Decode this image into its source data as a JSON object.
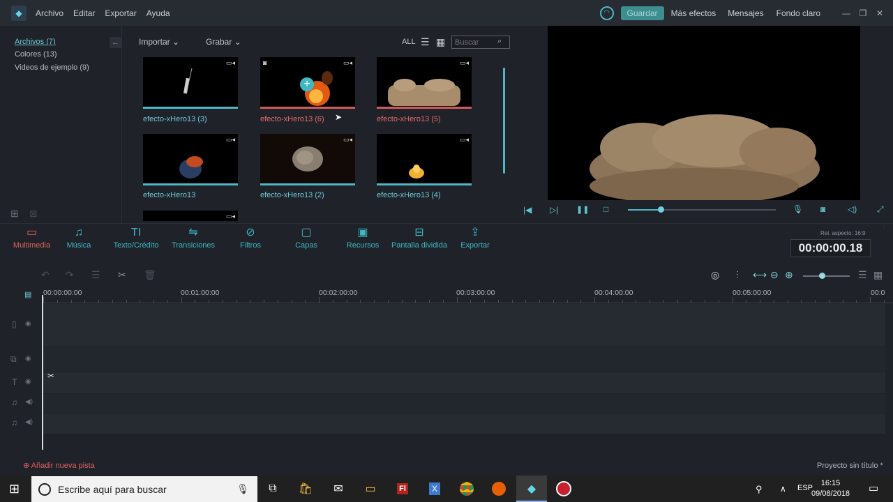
{
  "menu": [
    "Archivo",
    "Editar",
    "Exportar",
    "Ayuda"
  ],
  "top_right": {
    "save": "Guardar",
    "links": [
      "Más efectos",
      "Mensajes",
      "Fondo claro"
    ]
  },
  "sidebar": {
    "items": [
      {
        "label": "Archivos (7)"
      },
      {
        "label": "Colores (13)"
      },
      {
        "label": "Videos de ejemplo (9)"
      }
    ]
  },
  "media_toolbar": {
    "import": "Importar",
    "record": "Grabar",
    "all": "ALL",
    "search_placeholder": "Buscar"
  },
  "thumbnails": [
    {
      "label": "efecto-xHero13 (3)",
      "state": "normal"
    },
    {
      "label": "efecto-xHero13 (6)",
      "state": "selected"
    },
    {
      "label": "efecto-xHero13 (5)",
      "state": "selected"
    },
    {
      "label": "efecto-xHero13",
      "state": "normal"
    },
    {
      "label": "efecto-xHero13 (2)",
      "state": "normal"
    },
    {
      "label": "efecto-xHero13 (4)",
      "state": "normal"
    }
  ],
  "player": {
    "progress": 0.22
  },
  "tabs": [
    {
      "label": "Multimedia",
      "icon": "folder-icon",
      "active": true
    },
    {
      "label": "Música",
      "icon": "music-icon"
    },
    {
      "label": "Texto/Crédito",
      "icon": "text-icon"
    },
    {
      "label": "Transiciones",
      "icon": "transition-icon"
    },
    {
      "label": "Filtros",
      "icon": "filter-icon"
    },
    {
      "label": "Capas",
      "icon": "overlay-icon"
    },
    {
      "label": "Recursos",
      "icon": "image-icon"
    },
    {
      "label": "Pantalla dividida",
      "icon": "split-screen-icon"
    },
    {
      "label": "Exportar",
      "icon": "export-icon"
    }
  ],
  "aspect": "Rel. aspecto: 16:9",
  "timecode": "00:00:00.18",
  "ruler": [
    "00:00:00:00",
    "00:01:00:00",
    "00:02:00:00",
    "00:03:00:00",
    "00:04:00:00",
    "00:05:00:00",
    "00:0"
  ],
  "timeline": {
    "add_track": "Añadir nueva pista",
    "project": "Proyecto sin título *",
    "zoom": 0.4
  },
  "taskbar": {
    "search_placeholder": "Escribe aquí para buscar",
    "lang": "ESP",
    "time": "16:15",
    "date": "09/08/2018"
  },
  "colors": {
    "accent": "#4fb7c5",
    "active_red": "#e06060",
    "bg": "#1f2229"
  }
}
